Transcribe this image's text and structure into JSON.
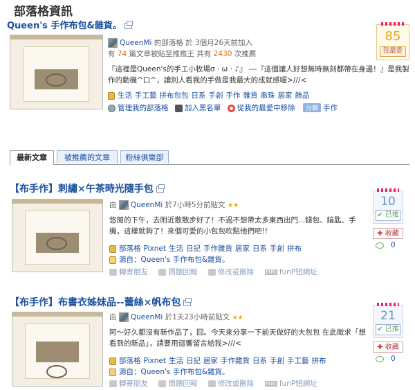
{
  "page_title": "部落格資訊",
  "blog": {
    "title": "Queen's 手作布包&雜貨。",
    "owner": "QueenMi",
    "owner_suffix": " 的部落格 於 3個月26天前加入",
    "stats_prefix": "有 ",
    "push_count": "74",
    "stats_mid": " 篇文章被貼至推推王 共有 ",
    "views": "2430",
    "stats_suffix": " 次推薦",
    "description": "『這裡是Queen's的手工小牧場σ · ω · ♪』 ---『這個讓人好想無時無刻都帶在身邊！』是我製作的動機^口^，讓別人看我的手做是我最大的成就感喔>///<",
    "tags": [
      "生活",
      "手工藝",
      "拼布包包",
      "日系",
      "手創",
      "手作",
      "雜貨",
      "串珠",
      "居家",
      "飾品"
    ],
    "actions": {
      "manage": "管理我的部落格",
      "blacklist": "加入黑名單",
      "remove_fav": "從我的最愛中移除",
      "share_badge": "分類",
      "share_label": "手作"
    },
    "fav": {
      "count": "85",
      "label": "我最愛"
    }
  },
  "tabs": [
    {
      "label": "最新文章",
      "active": true
    },
    {
      "label": "被推薦的文章",
      "active": false
    },
    {
      "label": "粉絲俱樂部",
      "active": false
    }
  ],
  "posts": [
    {
      "title": "【布手作】刺繡×午茶時光隨手包",
      "by_prefix": "由 ",
      "author": "QueenMi",
      "time": " 於7小時5分前貼文",
      "stars": "★★",
      "excerpt": "悠閒的下午，去附近散散步好了！不過不想帶太多東西出門...錢包、鑰匙、手機，這樣就夠了！來個可愛的小包包吹點他們吧!!",
      "tags": [
        "部落格",
        "Pixnet",
        "生活",
        "日記",
        "手作雜貨",
        "居家",
        "日系",
        "手創",
        "拼布"
      ],
      "source_prefix": "源自：",
      "source": "Queen's 手作布包&雜貨。",
      "push_count": "10",
      "push_label": "已推",
      "collect_label": "收藏",
      "comments": "0",
      "actions": [
        "轉寄朋友",
        "問題回報",
        "修改或刪除",
        "funP短網址"
      ]
    },
    {
      "title": "【布手作】布書衣姊妹品--蕾絲×帆布包",
      "by_prefix": "由 ",
      "author": "QueenMi",
      "time": " 於1天23小時前貼文",
      "stars": "★★",
      "excerpt": "阿～好久都沒有新作品了，囧。今天來分享一下前天做好的大包包 在此徵求「想看到的新品」，請要用迴響留言給我>///<",
      "tags": [
        "部落格",
        "Pixnet",
        "生活",
        "日記",
        "居家",
        "手作雜貨",
        "日系",
        "手創",
        "手工藝",
        "拼布"
      ],
      "source_prefix": "源自：",
      "source": "Queen's 手作布包&雜貨。",
      "push_count": "21",
      "push_label": "已推",
      "collect_label": "收藏",
      "comments": "0",
      "actions": [
        "轉寄朋友",
        "問題回報",
        "修改或刪除",
        "funP短網址"
      ]
    }
  ]
}
